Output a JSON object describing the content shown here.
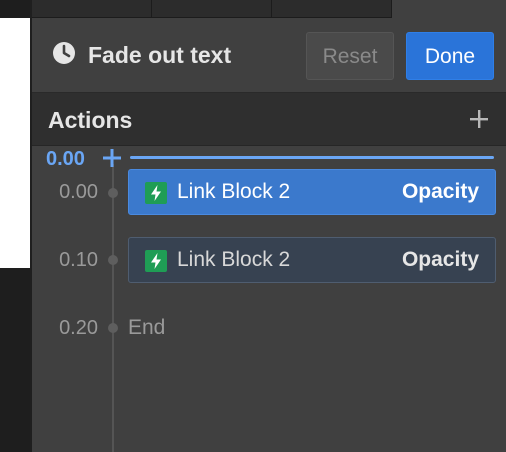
{
  "header": {
    "title": "Fade out text",
    "reset_label": "Reset",
    "done_label": "Done",
    "icon": "clock-icon"
  },
  "actions_bar": {
    "label": "Actions",
    "add_icon": "plus-icon"
  },
  "timeline": {
    "playhead_time": "0.00",
    "playhead_icon": "plus-icon",
    "rows": [
      {
        "time": "0.00",
        "target": "Link Block 2",
        "property": "Opacity",
        "icon": "lightning-icon",
        "selected": true
      },
      {
        "time": "0.10",
        "target": "Link Block 2",
        "property": "Opacity",
        "icon": "lightning-icon",
        "selected": false
      }
    ],
    "end": {
      "time": "0.20",
      "label": "End"
    }
  },
  "colors": {
    "accent": "#2a74d9",
    "playhead": "#6aa6f5",
    "selected_row": "#3b79cc",
    "action_icon_bg": "#1f9d55",
    "panel_bg": "#404040"
  }
}
